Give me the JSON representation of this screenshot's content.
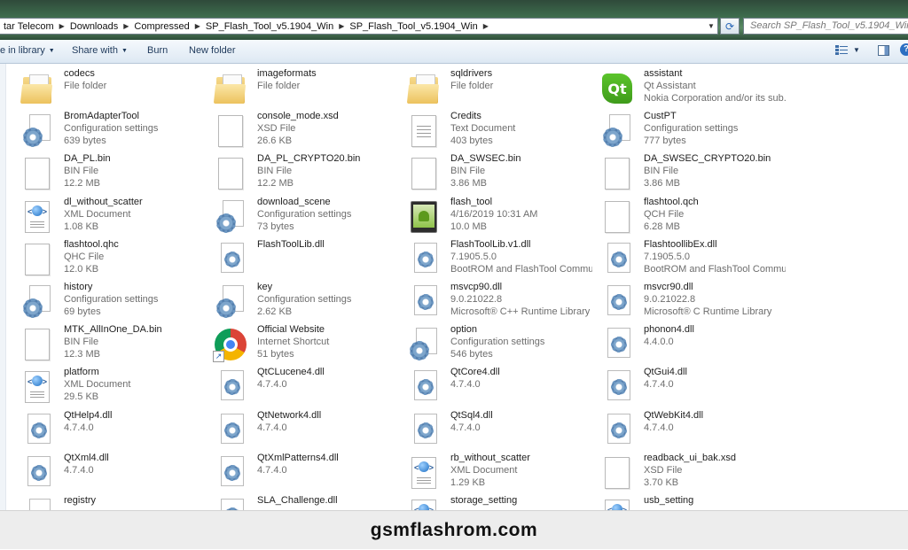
{
  "address": {
    "crumbs": [
      "tar Telecom",
      "Downloads",
      "Compressed",
      "SP_Flash_Tool_v5.1904_Win",
      "SP_Flash_Tool_v5.1904_Win"
    ],
    "search_placeholder": "Search SP_Flash_Tool_v5.1904_Win"
  },
  "toolbar": {
    "include_label": "e in library",
    "share_label": "Share with",
    "burn_label": "Burn",
    "new_folder_label": "New folder"
  },
  "items": [
    {
      "name": "codecs",
      "l1": "File folder",
      "l2": "",
      "icon": "folder-icon"
    },
    {
      "name": "imageformats",
      "l1": "File folder",
      "l2": "",
      "icon": "folder-icon"
    },
    {
      "name": "sqldrivers",
      "l1": "File folder",
      "l2": "",
      "icon": "folder-icon"
    },
    {
      "name": "assistant",
      "l1": "Qt Assistant",
      "l2": "Nokia Corporation and/or its sub...",
      "icon": "qt-icon"
    },
    {
      "name": "BromAdapterTool",
      "l1": "Configuration settings",
      "l2": "639 bytes",
      "icon": "config-icon"
    },
    {
      "name": "console_mode.xsd",
      "l1": "XSD File",
      "l2": "26.6 KB",
      "icon": "file-icon"
    },
    {
      "name": "Credits",
      "l1": "Text Document",
      "l2": "403 bytes",
      "icon": "text-file-icon"
    },
    {
      "name": "CustPT",
      "l1": "Configuration settings",
      "l2": "777 bytes",
      "icon": "config-icon"
    },
    {
      "name": "DA_PL.bin",
      "l1": "BIN File",
      "l2": "12.2 MB",
      "icon": "file-icon"
    },
    {
      "name": "DA_PL_CRYPTO20.bin",
      "l1": "BIN File",
      "l2": "12.2 MB",
      "icon": "file-icon"
    },
    {
      "name": "DA_SWSEC.bin",
      "l1": "BIN File",
      "l2": "3.86 MB",
      "icon": "file-icon"
    },
    {
      "name": "DA_SWSEC_CRYPTO20.bin",
      "l1": "BIN File",
      "l2": "3.86 MB",
      "icon": "file-icon"
    },
    {
      "name": "dl_without_scatter",
      "l1": "XML Document",
      "l2": "1.08 KB",
      "icon": "xml-icon"
    },
    {
      "name": "download_scene",
      "l1": "Configuration settings",
      "l2": "73 bytes",
      "icon": "config-icon"
    },
    {
      "name": "flash_tool",
      "l1": "4/16/2019 10:31 AM",
      "l2": "10.0 MB",
      "icon": "android-app-icon"
    },
    {
      "name": "flashtool.qch",
      "l1": "QCH File",
      "l2": "6.28 MB",
      "icon": "file-icon"
    },
    {
      "name": "flashtool.qhc",
      "l1": "QHC File",
      "l2": "12.0 KB",
      "icon": "file-icon"
    },
    {
      "name": "FlashToolLib.dll",
      "l1": "",
      "l2": "",
      "icon": "dll-icon"
    },
    {
      "name": "FlashToolLib.v1.dll",
      "l1": "7.1905.5.0",
      "l2": "BootROM and FlashTool Commu...",
      "icon": "dll-icon"
    },
    {
      "name": "FlashtoollibEx.dll",
      "l1": "7.1905.5.0",
      "l2": "BootROM and FlashTool Commu...",
      "icon": "dll-icon"
    },
    {
      "name": "history",
      "l1": "Configuration settings",
      "l2": "69 bytes",
      "icon": "config-icon"
    },
    {
      "name": "key",
      "l1": "Configuration settings",
      "l2": "2.62 KB",
      "icon": "config-icon"
    },
    {
      "name": "msvcp90.dll",
      "l1": "9.0.21022.8",
      "l2": "Microsoft® C++ Runtime Library",
      "icon": "dll-icon"
    },
    {
      "name": "msvcr90.dll",
      "l1": "9.0.21022.8",
      "l2": "Microsoft® C Runtime Library",
      "icon": "dll-icon"
    },
    {
      "name": "MTK_AllInOne_DA.bin",
      "l1": "BIN File",
      "l2": "12.3 MB",
      "icon": "file-icon"
    },
    {
      "name": "Official Website",
      "l1": "Internet Shortcut",
      "l2": "51 bytes",
      "icon": "chrome-icon"
    },
    {
      "name": "option",
      "l1": "Configuration settings",
      "l2": "546 bytes",
      "icon": "config-icon"
    },
    {
      "name": "phonon4.dll",
      "l1": "4.4.0.0",
      "l2": "",
      "icon": "dll-icon"
    },
    {
      "name": "platform",
      "l1": "XML Document",
      "l2": "29.5 KB",
      "icon": "xml-icon"
    },
    {
      "name": "QtCLucene4.dll",
      "l1": "4.7.4.0",
      "l2": "",
      "icon": "dll-icon"
    },
    {
      "name": "QtCore4.dll",
      "l1": "4.7.4.0",
      "l2": "",
      "icon": "dll-icon"
    },
    {
      "name": "QtGui4.dll",
      "l1": "4.7.4.0",
      "l2": "",
      "icon": "dll-icon"
    },
    {
      "name": "QtHelp4.dll",
      "l1": "4.7.4.0",
      "l2": "",
      "icon": "dll-icon"
    },
    {
      "name": "QtNetwork4.dll",
      "l1": "4.7.4.0",
      "l2": "",
      "icon": "dll-icon"
    },
    {
      "name": "QtSql4.dll",
      "l1": "4.7.4.0",
      "l2": "",
      "icon": "dll-icon"
    },
    {
      "name": "QtWebKit4.dll",
      "l1": "4.7.4.0",
      "l2": "",
      "icon": "dll-icon"
    },
    {
      "name": "QtXml4.dll",
      "l1": "4.7.4.0",
      "l2": "",
      "icon": "dll-icon"
    },
    {
      "name": "QtXmlPatterns4.dll",
      "l1": "4.7.4.0",
      "l2": "",
      "icon": "dll-icon"
    },
    {
      "name": "rb_without_scatter",
      "l1": "XML Document",
      "l2": "1.29 KB",
      "icon": "xml-icon"
    },
    {
      "name": "readback_ui_bak.xsd",
      "l1": "XSD File",
      "l2": "3.70 KB",
      "icon": "file-icon"
    },
    {
      "name": "registry",
      "l1": "",
      "l2": "",
      "icon": "config-icon"
    },
    {
      "name": "SLA_Challenge.dll",
      "l1": "",
      "l2": "",
      "icon": "dll-icon"
    },
    {
      "name": "storage_setting",
      "l1": "",
      "l2": "",
      "icon": "xml-icon"
    },
    {
      "name": "usb_setting",
      "l1": "",
      "l2": "",
      "icon": "xml-icon"
    }
  ],
  "watermark": "gsmflashrom.com"
}
